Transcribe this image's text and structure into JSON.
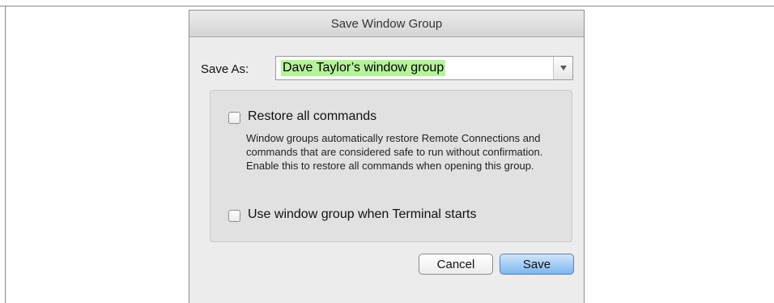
{
  "dialog": {
    "title": "Save Window Group",
    "save_as_label": "Save As:",
    "save_as_value": "Dave Taylor’s window group",
    "options": {
      "restore_all": {
        "label": "Restore all commands",
        "checked": false
      },
      "description": "Window groups automatically restore Remote Connections and commands that are considered safe to run without confirmation. Enable this to restore all commands when opening this group.",
      "use_on_start": {
        "label": "Use window group when Terminal starts",
        "checked": false
      }
    },
    "buttons": {
      "cancel": "Cancel",
      "save": "Save"
    },
    "colors": {
      "highlight": "#b6f29a",
      "default_button": "#7cb6ee"
    },
    "icons": {
      "combo_dropdown": "chevron-down-icon"
    }
  }
}
